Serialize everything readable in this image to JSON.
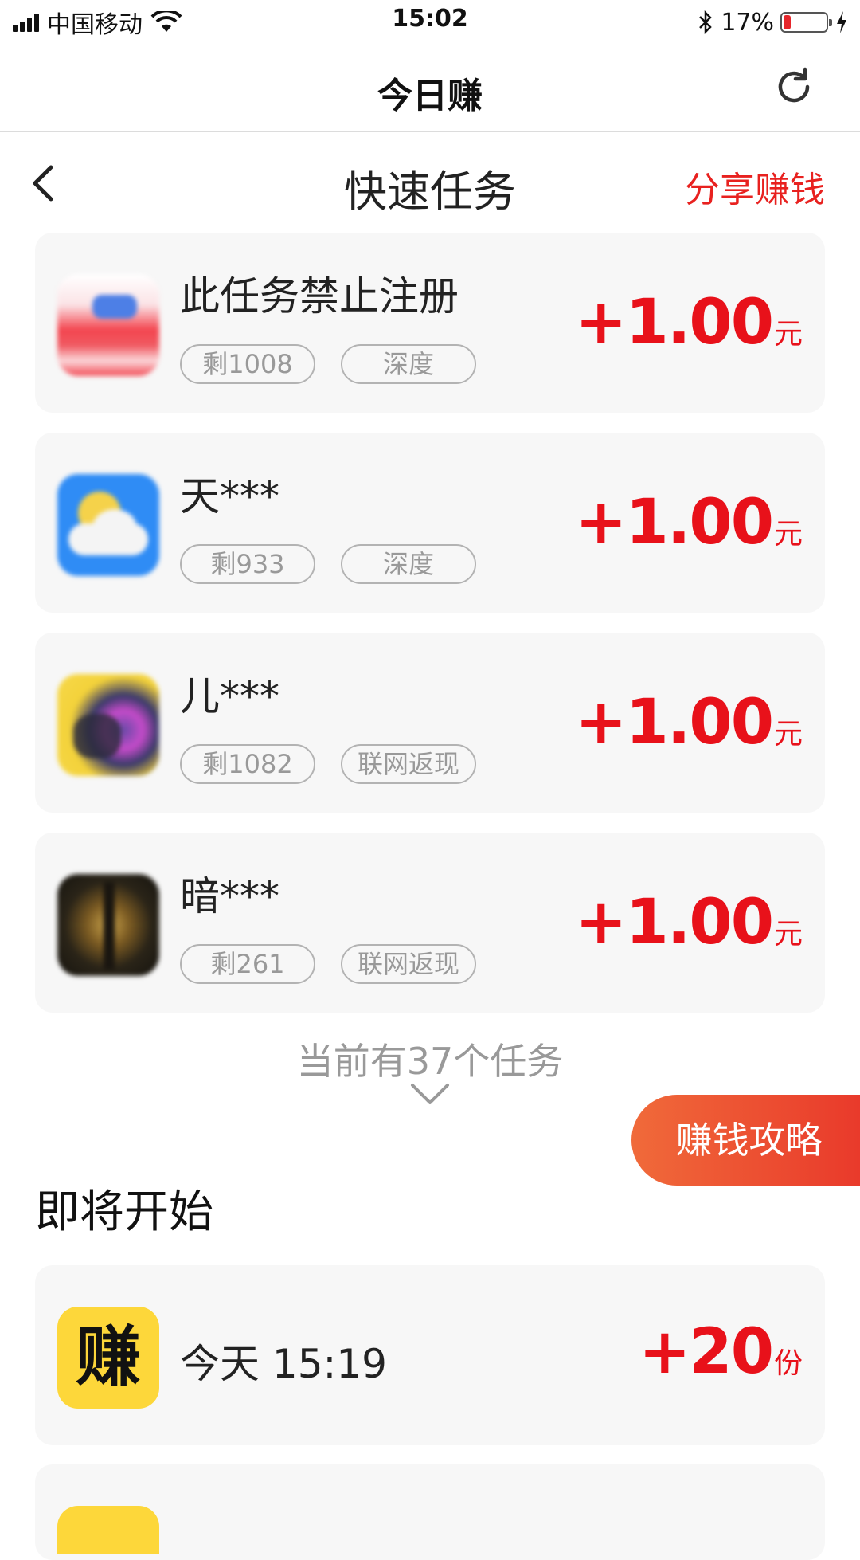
{
  "status_bar": {
    "carrier": "中国移动",
    "time": "15:02",
    "battery_percent": "17%",
    "battery_level": 0.17
  },
  "nav": {
    "title": "今日赚",
    "refresh_icon": "refresh-icon"
  },
  "sub_header": {
    "title": "快速任务",
    "share_label": "分享赚钱",
    "back_icon": "chevron-left-icon"
  },
  "tasks": [
    {
      "name": "此任务禁止注册",
      "remaining": "剩1008",
      "type": "深度",
      "amount": "+1.00",
      "unit": "元",
      "icon": "blurred-app-icon-red"
    },
    {
      "name": "天***",
      "remaining": "剩933",
      "type": "深度",
      "amount": "+1.00",
      "unit": "元",
      "icon": "weather-app-icon"
    },
    {
      "name": "儿***",
      "remaining": "剩1082",
      "type": "联网返现",
      "amount": "+1.00",
      "unit": "元",
      "icon": "blurred-game-icon"
    },
    {
      "name": "暗***",
      "remaining": "剩261",
      "type": "联网返现",
      "amount": "+1.00",
      "unit": "元",
      "icon": "blurred-dark-game-icon"
    }
  ],
  "task_count_text": "当前有37个任务",
  "guide_button": "赚钱攻略",
  "upcoming": {
    "title": "即将开始",
    "items": [
      {
        "icon_text": "赚",
        "time": "今天 15:19",
        "amount": "+20",
        "unit": "份"
      }
    ]
  },
  "colors": {
    "accent_red": "#e8111a",
    "card_bg": "#f7f7f7",
    "guide_gradient_start": "#f06a3a",
    "guide_gradient_end": "#e93a2b",
    "zhuan_icon_bg": "#fdd73a"
  }
}
